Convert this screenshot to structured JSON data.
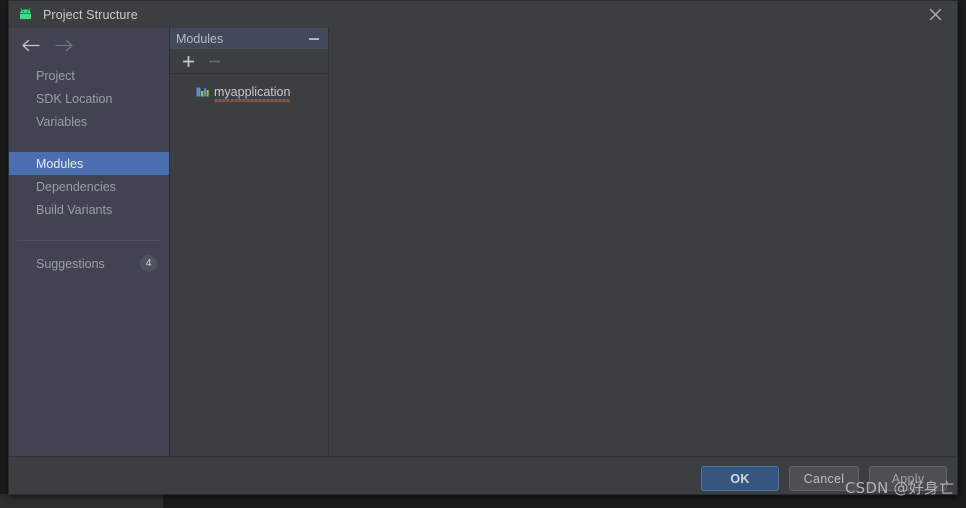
{
  "window": {
    "title": "Project Structure",
    "app_icon": "android-robot-icon",
    "close_icon": "close-icon",
    "background_color": "#3c3f41"
  },
  "navigation": {
    "back_icon": "arrow-left-icon",
    "forward_icon": "arrow-right-icon"
  },
  "sidebar": {
    "background_color": "#414450",
    "selected_color": "#4b6eaf",
    "items": [
      {
        "label": "Project",
        "selected": false
      },
      {
        "label": "SDK Location",
        "selected": false
      },
      {
        "label": "Variables",
        "selected": false
      },
      {
        "label": "Modules",
        "selected": true
      },
      {
        "label": "Dependencies",
        "selected": false
      },
      {
        "label": "Build Variants",
        "selected": false
      },
      {
        "label": "Suggestions",
        "selected": false,
        "badge": "4"
      }
    ]
  },
  "modules_panel": {
    "header_title": "Modules",
    "header_background": "#41495a",
    "collapse_icon": "minus-icon",
    "toolbar": {
      "add_icon": "plus-icon",
      "add_enabled": true,
      "remove_icon": "minus-icon",
      "remove_enabled": false
    },
    "items": [
      {
        "label": "myapplication",
        "icon": "module-bar-chart-icon",
        "spellcheck_underline": true,
        "underline_color": "#b8531f"
      }
    ]
  },
  "detail_panel": {
    "content": "",
    "background_color": "#3c3f41"
  },
  "footer": {
    "ok_label": "OK",
    "cancel_label": "Cancel",
    "apply_label": "Apply",
    "ok_color": "#365880"
  },
  "watermark": {
    "text": "CSDN @好身亡"
  }
}
